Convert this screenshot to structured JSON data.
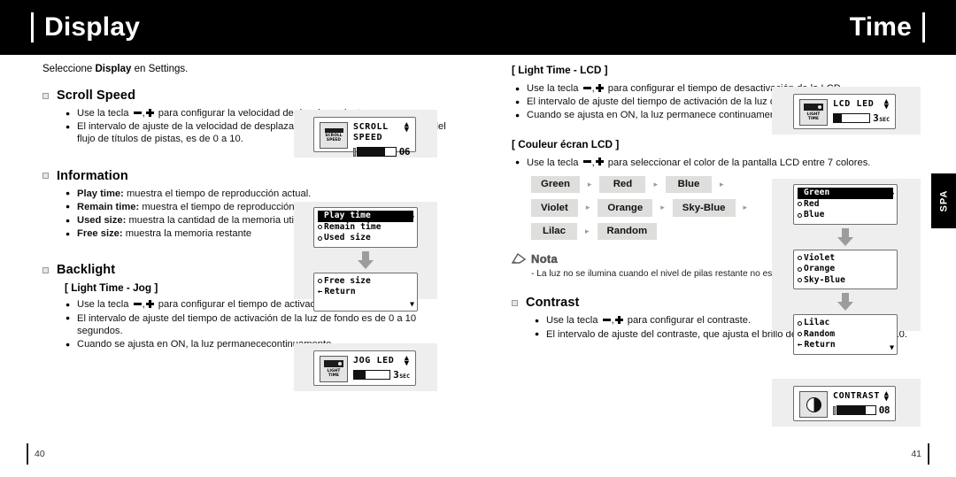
{
  "header": {
    "left_title": "Display",
    "right_title": "Time"
  },
  "side_tab": {
    "label": "SPA"
  },
  "footer": {
    "left_page": "40",
    "right_page": "41"
  },
  "left_column": {
    "intro_before": "Seleccione ",
    "intro_bold": "Display",
    "intro_after": " en Settings.",
    "scroll_speed": {
      "title": "Scroll Speed",
      "bullets": [
        "Use la tecla —,+ para configurar la velocidad de desplazamiento.",
        "El intervalo de ajuste de la velocidad de desplazamiento, que ajusta la velocidad del flujo de títulos de pistas, es de 0 a 10."
      ],
      "b1_pre": "Use la tecla",
      "b1_post": "para configurar la velocidad de desplazamiento.",
      "b2": "El intervalo de ajuste de la velocidad de desplazamiento, que ajusta la velocidad del flujo de títulos de pistas, es de 0 a 10.",
      "lcd": {
        "icon_label": "SCROLL\nSPEED",
        "icon_line1": "SCROLL",
        "icon_line2": "SPEED",
        "title": "SCROLL SPEED",
        "value": "06",
        "fill_percent": 72
      }
    },
    "information": {
      "title": "Information",
      "items": [
        {
          "term": "Play time:",
          "desc": " muestra el tiempo de reproducción actual."
        },
        {
          "term": "Remain time:",
          "desc": " muestra el tiempo de reproducción restante."
        },
        {
          "term": "Used size:",
          "desc": " muestra la cantidad de la memoria utilizada."
        },
        {
          "term": "Free size:",
          "desc": " muestra la memoria restante"
        }
      ],
      "lcd_screen1": [
        "Play time",
        "Remain time",
        "Used size"
      ],
      "lcd_screen1_selected": "Play time",
      "lcd_screen2": [
        "Free size",
        "Return"
      ]
    },
    "backlight": {
      "title": "Backlight",
      "subtitle": "[ Light Time - Jog ]",
      "b1_pre": "Use la tecla",
      "b1_post": "para configurar el tiempo de activación de la luz de fondo.",
      "b2": "El intervalo de ajuste del tiempo de activación de la luz de fondo es de 0 a 10 segundos.",
      "b3": "Cuando se ajusta en ON, la luz permanececontinuamente.",
      "lcd": {
        "icon_line1": "LIGHT",
        "icon_line2": "TIME",
        "title": "JOG LED",
        "value": "3",
        "unit": "SEC",
        "fill_percent": 32
      }
    }
  },
  "right_column": {
    "light_time_lcd": {
      "subtitle": "[ Light Time - LCD ]",
      "b1_pre": "Use la tecla",
      "b1_post": "para configurar el tiempo de desactivación de la LCD.",
      "b2": "El intervalo de ajuste del tiempo de activación de la luz de fondo es de 0 a 10 segundos.",
      "b3": "Cuando se ajusta en ON, la luz permanece continuamente.",
      "lcd": {
        "icon_line1": "LIGHT",
        "icon_line2": "TIME",
        "title": "LCD LED",
        "value": "3",
        "unit": "SEC",
        "fill_percent": 22
      }
    },
    "lcd_color": {
      "subtitle": "[ Couleur écran LCD ]",
      "b1_pre": "Use la tecla",
      "b1_post": "para seleccionar el color de la pantalla LCD entre 7 colores.",
      "chips": [
        [
          "Green",
          "Red",
          "Blue"
        ],
        [
          "Violet",
          "Orange",
          "Sky-Blue"
        ],
        [
          "Lilac",
          "Random"
        ]
      ],
      "chip_separator": "▸",
      "lcd_screen1": [
        "Green",
        "Red",
        "Blue"
      ],
      "lcd_screen1_selected": "Green",
      "lcd_screen2": [
        "Violet",
        "Orange",
        "Sky-Blue"
      ],
      "lcd_screen3": [
        "Lilac",
        "Random",
        "Return"
      ]
    },
    "note": {
      "label": "Nota",
      "text": "- La luz no se ilumina cuando el nivel de pilas restante no es suficiente."
    },
    "contrast": {
      "title": "Contrast",
      "b1_pre": "Use la tecla",
      "b1_post": "para configurar el contraste.",
      "b2": "El intervalo de ajuste del contraste, que ajusta el brillo de la pantalla, es de 0 a 10.",
      "lcd": {
        "title": "CONTRAST",
        "value": "08",
        "fill_percent": 76
      }
    }
  }
}
